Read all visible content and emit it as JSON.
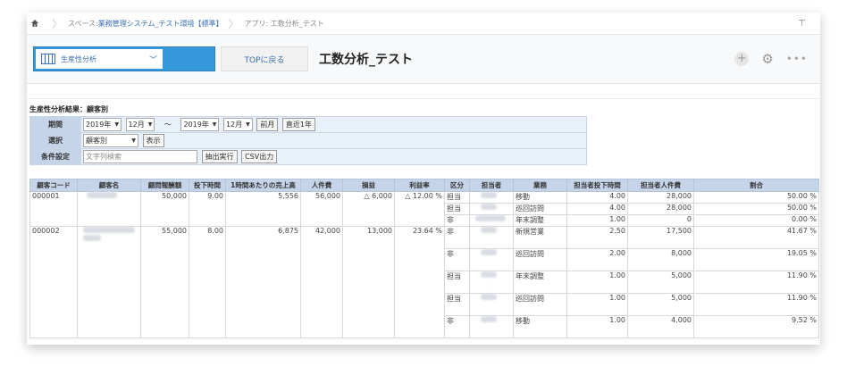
{
  "breadcrumb": {
    "space_prefix": "スペース:",
    "space_name": "業務管理システム_テスト環境【標準】",
    "app": "アプリ: 工数分析_テスト"
  },
  "header": {
    "view_name": "生産性分析",
    "top_button": "TOPに戻る",
    "app_title": "工数分析_テスト"
  },
  "report_title": "生産性分析結果：顧客別",
  "filter": {
    "period_label": "期間",
    "year_from": "2019年",
    "month_from": "12月",
    "tilde": "～",
    "year_to": "2019年",
    "month_to": "12月",
    "prev_month": "前月",
    "last_year": "直近1年",
    "select_label": "選択",
    "select_value": "顧客別",
    "show_button": "表示",
    "condition_label": "条件設定",
    "search_placeholder": "文字列検索",
    "extract_button": "抽出実行",
    "csv_button": "CSV出力"
  },
  "table": {
    "headers": [
      "顧客コード",
      "顧客名",
      "顧問報酬額",
      "投下時間",
      "1時間あたりの売上高",
      "人件費",
      "損益",
      "利益率",
      "区分",
      "担当者",
      "業務",
      "担当者投下時間",
      "担当者人件費",
      "割合"
    ],
    "customers": [
      {
        "code": "000001",
        "fee": "50,000",
        "hours": "9.00",
        "per_hour": "5,556",
        "labor": "56,000",
        "profit": "△ 6,000",
        "rate": "△ 12.00 %",
        "negative": true
      },
      {
        "code": "000002",
        "fee": "55,000",
        "hours": "8.00",
        "per_hour": "6,875",
        "labor": "42,000",
        "profit": "13,000",
        "rate": "23.64 %",
        "negative": false
      }
    ],
    "rows": [
      {
        "kubun": "担当",
        "gyomu": "移動",
        "h": "4.00",
        "cost": "28,000",
        "pct": "50.00 %"
      },
      {
        "kubun": "担当",
        "gyomu": "巡回訪問",
        "h": "4.00",
        "cost": "28,000",
        "pct": "50.00 %"
      },
      {
        "kubun": "非",
        "gyomu": "年末調整",
        "h": "1.00",
        "cost": "0",
        "pct": "0.00 %"
      },
      {
        "kubun": "非",
        "gyomu": "新規営業",
        "h": "2.50",
        "cost": "17,500",
        "pct": "41.67 %"
      },
      {
        "kubun": "非",
        "gyomu": "巡回訪問",
        "h": "2.00",
        "cost": "8,000",
        "pct": "19.05 %"
      },
      {
        "kubun": "担当",
        "gyomu": "年末調整",
        "h": "1.00",
        "cost": "5,000",
        "pct": "11.90 %"
      },
      {
        "kubun": "担当",
        "gyomu": "巡回訪問",
        "h": "1.00",
        "cost": "5,000",
        "pct": "11.90 %"
      },
      {
        "kubun": "非",
        "gyomu": "移動",
        "h": "1.00",
        "cost": "4,000",
        "pct": "9.52 %"
      }
    ]
  }
}
